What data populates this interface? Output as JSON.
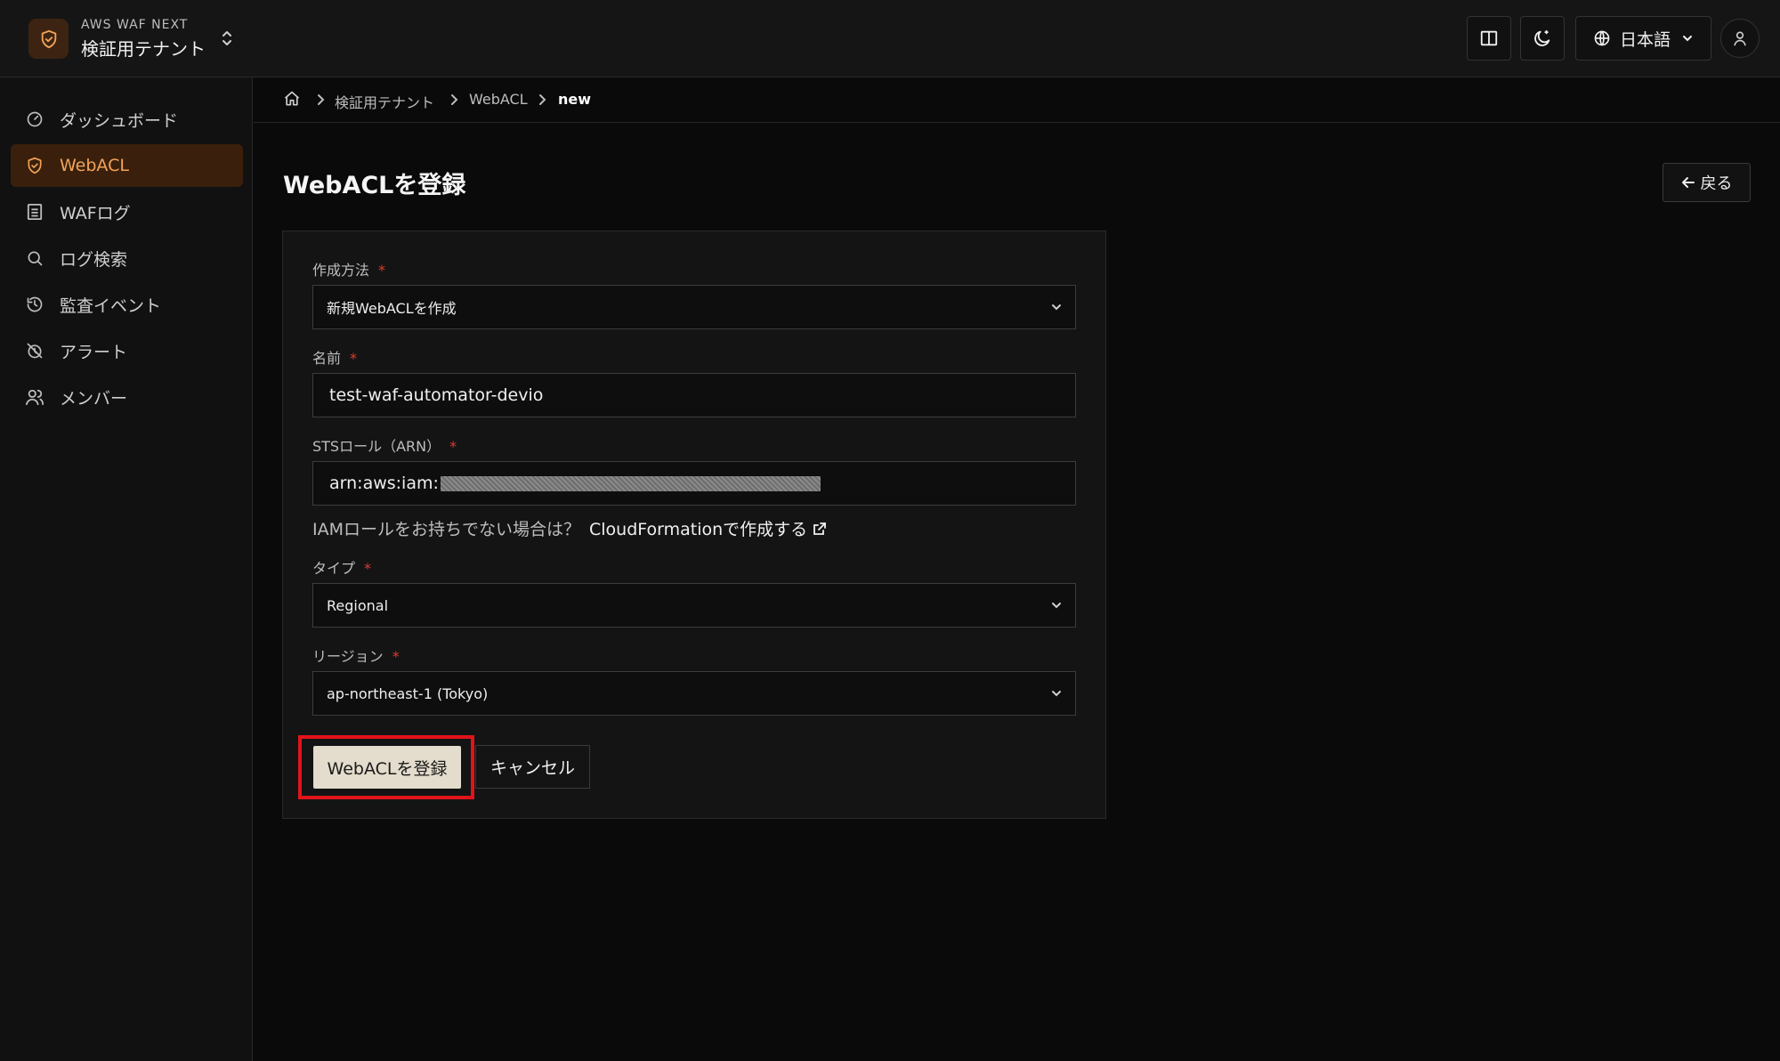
{
  "header": {
    "brand_small": "AWS WAF NEXT",
    "tenant_name": "検証用テナント",
    "language_label": "日本語",
    "accent_color": "#f2a35a"
  },
  "sidebar": {
    "items": [
      {
        "label": "ダッシュボード",
        "icon": "gauge-icon"
      },
      {
        "label": "WebACL",
        "icon": "shield-icon",
        "active": true
      },
      {
        "label": "WAFログ",
        "icon": "log-file-icon"
      },
      {
        "label": "ログ検索",
        "icon": "search-icon"
      },
      {
        "label": "監査イベント",
        "icon": "history-icon"
      },
      {
        "label": "アラート",
        "icon": "alarm-off-icon"
      },
      {
        "label": "メンバー",
        "icon": "users-icon"
      }
    ]
  },
  "breadcrumb": {
    "items": [
      "検証用テナント",
      "WebACL",
      "new"
    ]
  },
  "main": {
    "title": "WebACLを登録",
    "back_label": "戻る"
  },
  "form": {
    "method": {
      "label": "作成方法",
      "value": "新規WebACLを作成"
    },
    "name": {
      "label": "名前",
      "value": "test-waf-automator-devio"
    },
    "sts_role": {
      "label": "STSロール（ARN）",
      "value": "arn:aws:iam:"
    },
    "iam_hint": "IAMロールをお持ちでない場合は？",
    "iam_link": "CloudFormationで作成する",
    "type": {
      "label": "タイプ",
      "value": "Regional"
    },
    "region": {
      "label": "リージョン",
      "value": "ap-northeast-1 (Tokyo)"
    },
    "required_mark": "*",
    "submit_label": "WebACLを登録",
    "cancel_label": "キャンセル"
  }
}
